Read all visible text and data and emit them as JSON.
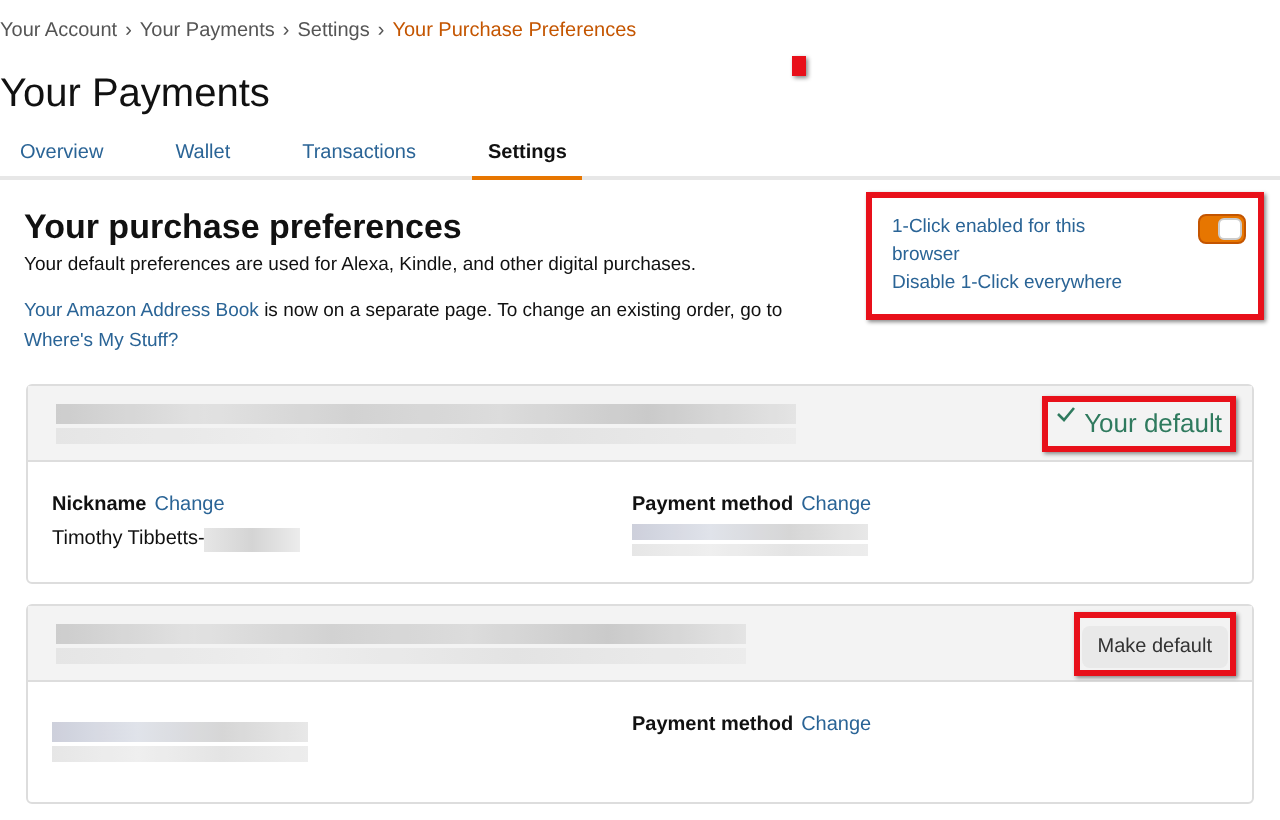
{
  "breadcrumb": [
    {
      "label": "Your Account",
      "current": false
    },
    {
      "label": "Your Payments",
      "current": false
    },
    {
      "label": "Settings",
      "current": false
    },
    {
      "label": "Your Purchase Preferences",
      "current": true
    }
  ],
  "breadcrumb_separator": "›",
  "title": "Your Payments",
  "tabs": [
    {
      "label": "Overview",
      "selected": false
    },
    {
      "label": "Wallet",
      "selected": false
    },
    {
      "label": "Transactions",
      "selected": false
    },
    {
      "label": "Settings",
      "selected": true
    }
  ],
  "section": {
    "heading": "Your purchase preferences",
    "description": "Your default preferences are used for Alexa, Kindle, and other digital purchases.",
    "address_link": "Your Amazon Address Book",
    "address_text": "is now on a separate page. To change an existing order, go to",
    "stuff_link": "Where's My Stuff?"
  },
  "one_click": {
    "status": "1-Click enabled for this browser",
    "disable_link": "Disable 1-Click everywhere",
    "on": true
  },
  "cards": [
    {
      "status": {
        "kind": "default",
        "label": "Your default"
      },
      "nickname": {
        "label": "Nickname",
        "change": "Change",
        "value": "Timothy Tibbetts-"
      },
      "payment": {
        "label": "Payment method",
        "change": "Change"
      }
    },
    {
      "status": {
        "kind": "button",
        "label": "Make default"
      },
      "payment": {
        "label": "Payment method",
        "change": "Change"
      }
    }
  ]
}
